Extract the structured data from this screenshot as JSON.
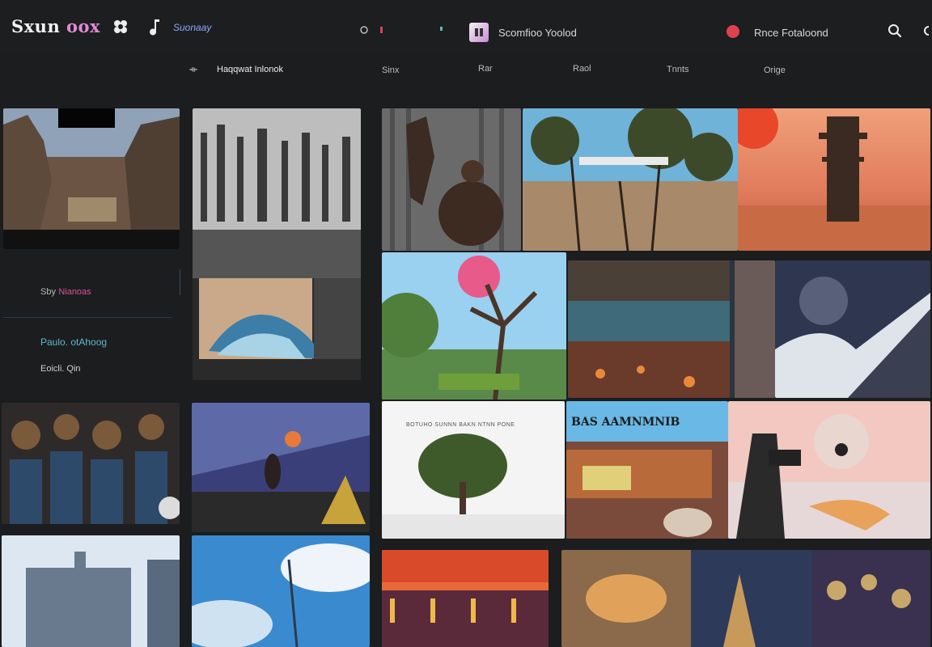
{
  "header": {
    "brand": "Sxun",
    "brand_suffix": "oox",
    "nav_link": "Suonaay",
    "center_label": "Scomfioo Yoolod",
    "right_label": "Rnce Fotaloond"
  },
  "toolbar": {
    "back_glyph": "⟛",
    "title": "Haqqwat Inlonok",
    "tabs": [
      "Sinx",
      "Rar",
      "Raol",
      "Tnnts",
      "Orige"
    ]
  },
  "sidebar": {
    "item1_prefix": "Sby",
    "item1_label": "Nianoas",
    "item2_label": "Paulo. otAhoog",
    "item3_label": "Eoicli. Qin"
  },
  "tiles": {
    "banner_text": "BAS AAMNMNIB",
    "tree_caption": "BOTUHO SUNNN BAKN NTNN PONE"
  },
  "colors": {
    "background": "#1b1d1f",
    "accent_pink": "#e08ad8",
    "accent_blue": "#8fa6ff",
    "status_red": "#e0414f",
    "sidebar_teal": "#5fb7c9"
  }
}
